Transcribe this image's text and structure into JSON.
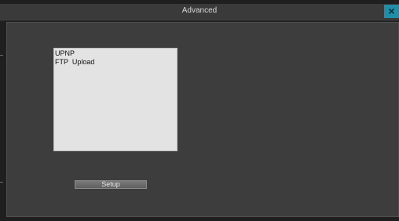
{
  "window": {
    "title": "Advanced",
    "close_label": "×"
  },
  "services_list": {
    "items": [
      "UPNP",
      "FTP  Upload"
    ]
  },
  "actions": {
    "setup_label": "Setup"
  },
  "colors": {
    "accent": "#1f8fa9",
    "panel_bg": "#3d3d3d",
    "list_bg": "#e3e3e3"
  }
}
